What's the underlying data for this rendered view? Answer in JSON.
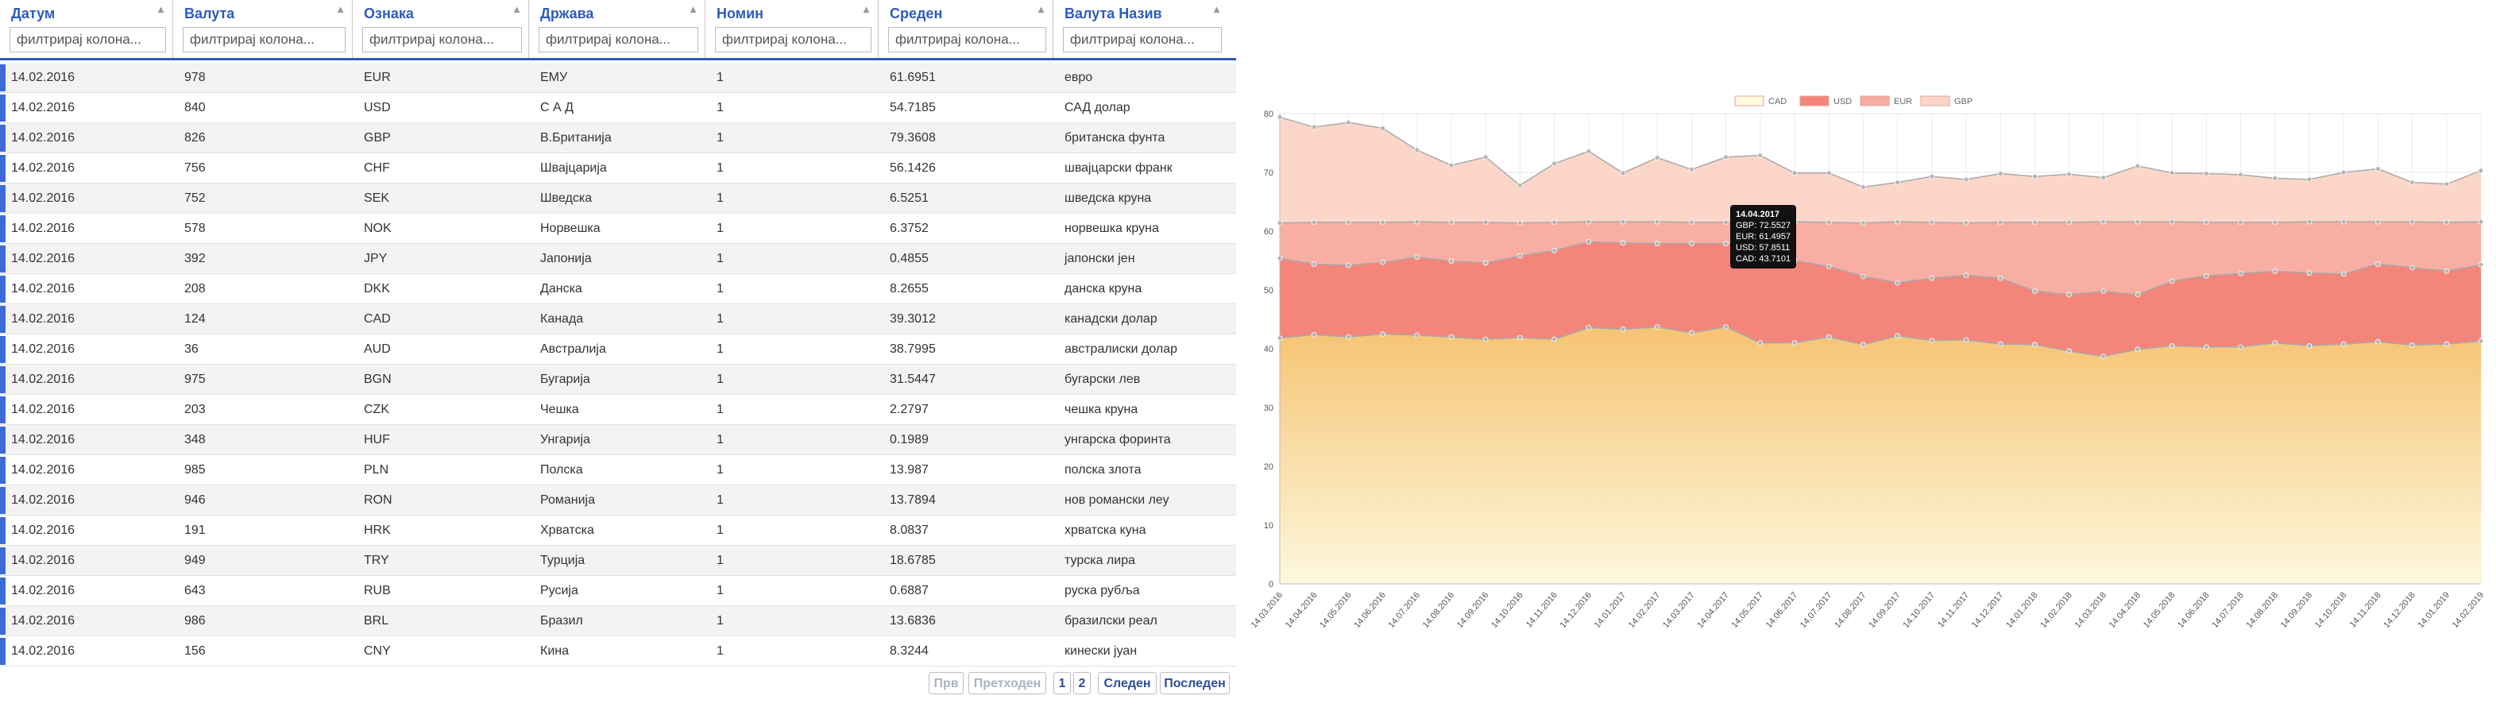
{
  "table": {
    "columns": [
      {
        "label": "Датум",
        "placeholder": "филтрирај колона..."
      },
      {
        "label": "Валута",
        "placeholder": "филтрирај колона..."
      },
      {
        "label": "Ознака",
        "placeholder": "филтрирај колона..."
      },
      {
        "label": "Држава",
        "placeholder": "филтрирај колона..."
      },
      {
        "label": "Номин",
        "placeholder": "филтрирај колона..."
      },
      {
        "label": "Среден",
        "placeholder": "филтрирај колона..."
      },
      {
        "label": "Валута Назив",
        "placeholder": "филтрирај колона..."
      }
    ],
    "rows": [
      [
        "14.02.2016",
        "978",
        "EUR",
        "ЕМУ",
        "1",
        "61.6951",
        "евро"
      ],
      [
        "14.02.2016",
        "840",
        "USD",
        "С А Д",
        "1",
        "54.7185",
        "САД долар"
      ],
      [
        "14.02.2016",
        "826",
        "GBP",
        "В.Британија",
        "1",
        "79.3608",
        "британска фунта"
      ],
      [
        "14.02.2016",
        "756",
        "CHF",
        "Швајцарија",
        "1",
        "56.1426",
        "швајцарски франк"
      ],
      [
        "14.02.2016",
        "752",
        "SEK",
        "Шведска",
        "1",
        "6.5251",
        "шведска круна"
      ],
      [
        "14.02.2016",
        "578",
        "NOK",
        "Норвешка",
        "1",
        "6.3752",
        "норвешка круна"
      ],
      [
        "14.02.2016",
        "392",
        "JPY",
        "Јапонија",
        "1",
        "0.4855",
        "јапонски јен"
      ],
      [
        "14.02.2016",
        "208",
        "DKK",
        "Данска",
        "1",
        "8.2655",
        "данска круна"
      ],
      [
        "14.02.2016",
        "124",
        "CAD",
        "Канада",
        "1",
        "39.3012",
        "канадски долар"
      ],
      [
        "14.02.2016",
        "36",
        "AUD",
        "Австралија",
        "1",
        "38.7995",
        "австралиски долар"
      ],
      [
        "14.02.2016",
        "975",
        "BGN",
        "Бугарија",
        "1",
        "31.5447",
        "бугарски лев"
      ],
      [
        "14.02.2016",
        "203",
        "CZK",
        "Чешка",
        "1",
        "2.2797",
        "чешка круна"
      ],
      [
        "14.02.2016",
        "348",
        "HUF",
        "Унгарија",
        "1",
        "0.1989",
        "унгарска форинта"
      ],
      [
        "14.02.2016",
        "985",
        "PLN",
        "Полска",
        "1",
        "13.987",
        "полска злота"
      ],
      [
        "14.02.2016",
        "946",
        "RON",
        "Романија",
        "1",
        "13.7894",
        "нов романски леу"
      ],
      [
        "14.02.2016",
        "191",
        "HRK",
        "Хрватска",
        "1",
        "8.0837",
        "хрватска куна"
      ],
      [
        "14.02.2016",
        "949",
        "TRY",
        "Турција",
        "1",
        "18.6785",
        "турска лира"
      ],
      [
        "14.02.2016",
        "643",
        "RUB",
        "Русија",
        "1",
        "0.6887",
        "руска рубља"
      ],
      [
        "14.02.2016",
        "986",
        "BRL",
        "Бразил",
        "1",
        "13.6836",
        "бразилски реал"
      ],
      [
        "14.02.2016",
        "156",
        "CNY",
        "Кина",
        "1",
        "8.3244",
        "кинески јуан"
      ]
    ],
    "pager": {
      "first": "Прв",
      "prev": "Претходен",
      "pages": [
        "1",
        "2"
      ],
      "next": "Следен",
      "last": "Последен"
    }
  },
  "chart_data": {
    "type": "area",
    "stacked": false,
    "x": [
      "14.03.2016",
      "14.04.2016",
      "14.05.2016",
      "14.06.2016",
      "14.07.2016",
      "14.08.2016",
      "14.09.2016",
      "14.10.2016",
      "14.11.2016",
      "14.12.2016",
      "14.01.2017",
      "14.02.2017",
      "14.03.2017",
      "14.04.2017",
      "14.05.2017",
      "14.06.2017",
      "14.07.2017",
      "14.08.2017",
      "14.09.2017",
      "14.10.2017",
      "14.11.2017",
      "14.12.2017",
      "14.01.2018",
      "14.02.2018",
      "14.03.2018",
      "14.04.2018",
      "14.05.2018",
      "14.06.2018",
      "14.07.2018",
      "14.08.2018",
      "14.09.2018",
      "14.10.2018",
      "14.11.2018",
      "14.12.2018",
      "14.01.2019",
      "14.02.2019"
    ],
    "ylim": [
      0,
      80
    ],
    "yticks": [
      0,
      10,
      20,
      30,
      40,
      50,
      60,
      70,
      80
    ],
    "legend_position": "top",
    "grid": true,
    "series": [
      {
        "name": "CAD",
        "color": "#f6c160",
        "values": [
          41.8,
          42.4,
          42.0,
          42.5,
          42.3,
          42.0,
          41.6,
          41.9,
          41.6,
          43.6,
          43.3,
          43.7,
          42.7,
          43.7,
          41.0,
          41.0,
          42.0,
          40.7,
          42.2,
          41.4,
          41.5,
          40.8,
          40.7,
          39.6,
          38.7,
          39.9,
          40.5,
          40.3,
          40.3,
          41.0,
          40.5,
          40.8,
          41.2,
          40.6,
          40.8,
          41.3
        ]
      },
      {
        "name": "USD",
        "color": "#f2776a",
        "values": [
          55.4,
          54.4,
          54.2,
          54.7,
          55.6,
          54.9,
          54.6,
          55.8,
          56.7,
          58.2,
          58.0,
          57.9,
          57.9,
          57.9,
          57.4,
          55.0,
          54.0,
          52.3,
          51.2,
          52.0,
          52.5,
          52.0,
          49.8,
          49.2,
          49.8,
          49.2,
          51.5,
          52.4,
          52.8,
          53.2,
          52.9,
          52.7,
          54.4,
          53.8,
          53.2,
          54.3
        ]
      },
      {
        "name": "EUR",
        "color": "#f5a49b",
        "values": [
          61.4,
          61.5,
          61.5,
          61.5,
          61.6,
          61.5,
          61.5,
          61.4,
          61.5,
          61.6,
          61.6,
          61.6,
          61.5,
          61.5,
          61.6,
          61.6,
          61.5,
          61.4,
          61.6,
          61.5,
          61.4,
          61.5,
          61.5,
          61.5,
          61.6,
          61.6,
          61.6,
          61.5,
          61.5,
          61.5,
          61.6,
          61.6,
          61.6,
          61.6,
          61.5,
          61.6
        ]
      },
      {
        "name": "GBP",
        "color": "#fbd0c3",
        "values": [
          79.4,
          77.7,
          78.5,
          77.5,
          73.8,
          71.2,
          72.6,
          67.8,
          71.5,
          73.6,
          69.9,
          72.5,
          70.5,
          72.6,
          72.9,
          69.9,
          69.9,
          67.5,
          68.3,
          69.3,
          68.8,
          69.8,
          69.3,
          69.7,
          69.1,
          71.1,
          69.9,
          69.8,
          69.6,
          69.0,
          68.8,
          70.0,
          70.6,
          68.3,
          68.0,
          70.3
        ]
      }
    ],
    "tooltip": {
      "title": "14.04.2017",
      "lines": [
        "GBP: 72.5527",
        "EUR: 61.4957",
        "USD: 57.8511",
        "CAD: 43.7101"
      ]
    }
  }
}
